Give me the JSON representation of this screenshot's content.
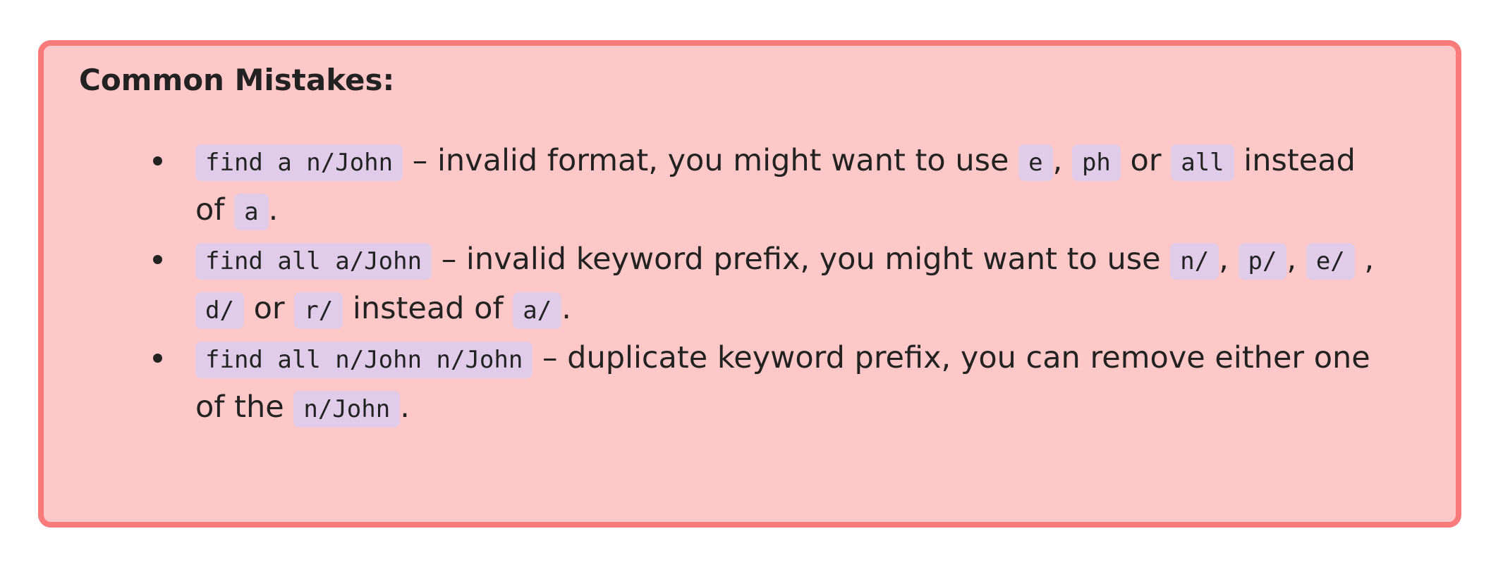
{
  "heading": "Common Mistakes:",
  "items": [
    {
      "code1": "find a n/John",
      "text1": " – invalid format, you might want to use ",
      "code2": "e",
      "text2": ", ",
      "code3": "ph",
      "text3": " or ",
      "code4": "all",
      "text4": " instead of ",
      "code5": "a",
      "text5": "."
    },
    {
      "code1": "find all a/John",
      "text1": " – invalid keyword prefix, you might want to use ",
      "code2": "n/",
      "text2": ", ",
      "code3": "p/",
      "text3": ", ",
      "code4": "e/",
      "text4": " , ",
      "code5": "d/",
      "text5": " or ",
      "code6": "r/",
      "text6": " instead of ",
      "code7": "a/",
      "text7": "."
    },
    {
      "code1": "find all n/John n/John",
      "text1": " – duplicate keyword prefix, you can remove either one of the ",
      "code2": "n/John",
      "text2": "."
    }
  ]
}
